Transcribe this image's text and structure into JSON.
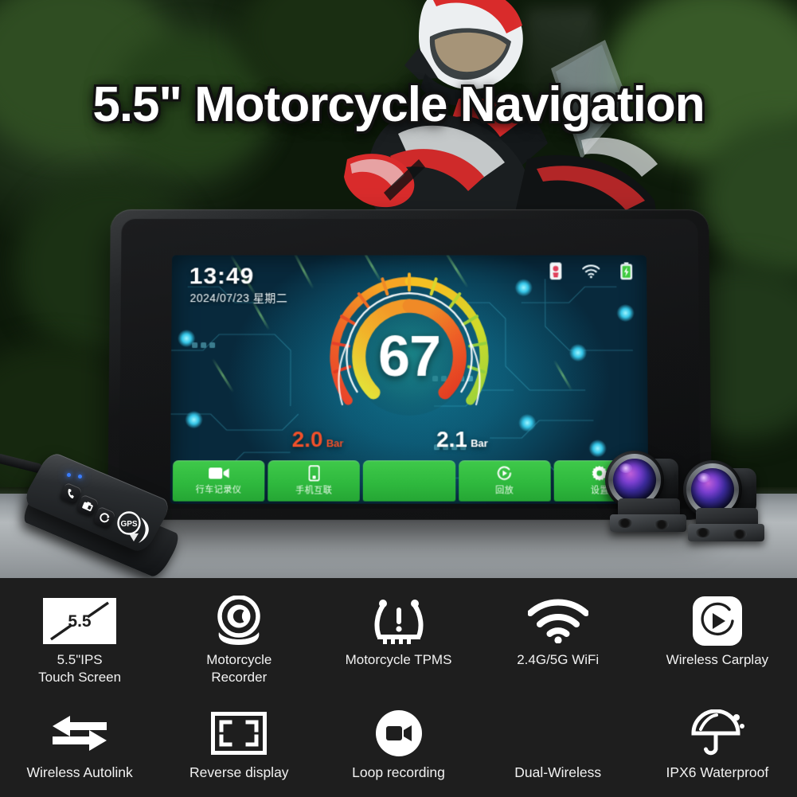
{
  "hero": {
    "title": "5.5\" Motorcycle Navigation"
  },
  "device": {
    "screen": {
      "status_bar": {
        "time": "13:49",
        "date": "2024/07/23 星期二",
        "icons": [
          {
            "name": "phone-link-icon",
            "glyph": "phone"
          },
          {
            "name": "wifi-icon",
            "glyph": "wifi"
          },
          {
            "name": "battery-icon",
            "glyph": "battery"
          }
        ]
      },
      "gauge": {
        "speed": "67",
        "unit_hidden": true,
        "tpms_left": {
          "value": "2.0",
          "unit": "Bar",
          "color": "#f0502a"
        },
        "tpms_right": {
          "value": "2.1",
          "unit": "Bar",
          "color": "#ffffff"
        },
        "ring_colors": [
          "#e8402a",
          "#f07a26",
          "#f5c022",
          "#c9d62a",
          "#8fce3a"
        ],
        "inner_colors": [
          "#d6e03a",
          "#f0a42a",
          "#ef5a27",
          "#e63a22"
        ]
      },
      "menu": [
        {
          "label": "行车记录仪",
          "icon": "video-camera-icon"
        },
        {
          "label": "手机互联",
          "icon": "smartphone-icon"
        },
        {
          "label": "",
          "icon": ""
        },
        {
          "label": "回放",
          "icon": "playback-icon"
        },
        {
          "label": "设置",
          "icon": "gear-icon"
        }
      ],
      "menu_color": "#2fb93e"
    }
  },
  "remote": {
    "badge": "GPS",
    "keys": [
      {
        "name": "call-key",
        "glyph": "phone"
      },
      {
        "name": "camera-key",
        "glyph": "camera"
      },
      {
        "name": "switch-key",
        "glyph": "refresh"
      }
    ]
  },
  "features": {
    "row1": [
      {
        "icon": "screen-size-icon",
        "badge": "5.5",
        "label": "5.5\"IPS\nTouch Screen"
      },
      {
        "icon": "dashcam-icon",
        "label": "Motorcycle\nRecorder"
      },
      {
        "icon": "tpms-icon",
        "label": "Motorcycle TPMS"
      },
      {
        "icon": "wifi-icon",
        "label": "2.4G/5G WiFi"
      },
      {
        "icon": "carplay-icon",
        "label": "Wireless Carplay"
      }
    ],
    "row2": [
      {
        "icon": "autolink-arrows-icon",
        "label": "Wireless Autolink"
      },
      {
        "icon": "reverse-display-icon",
        "label": "Reverse display"
      },
      {
        "icon": "loop-recording-icon",
        "label": "Loop recording"
      },
      {
        "icon": "",
        "label": "Dual-Wireless"
      },
      {
        "icon": "umbrella-icon",
        "label": "IPX6 Waterproof"
      }
    ]
  }
}
